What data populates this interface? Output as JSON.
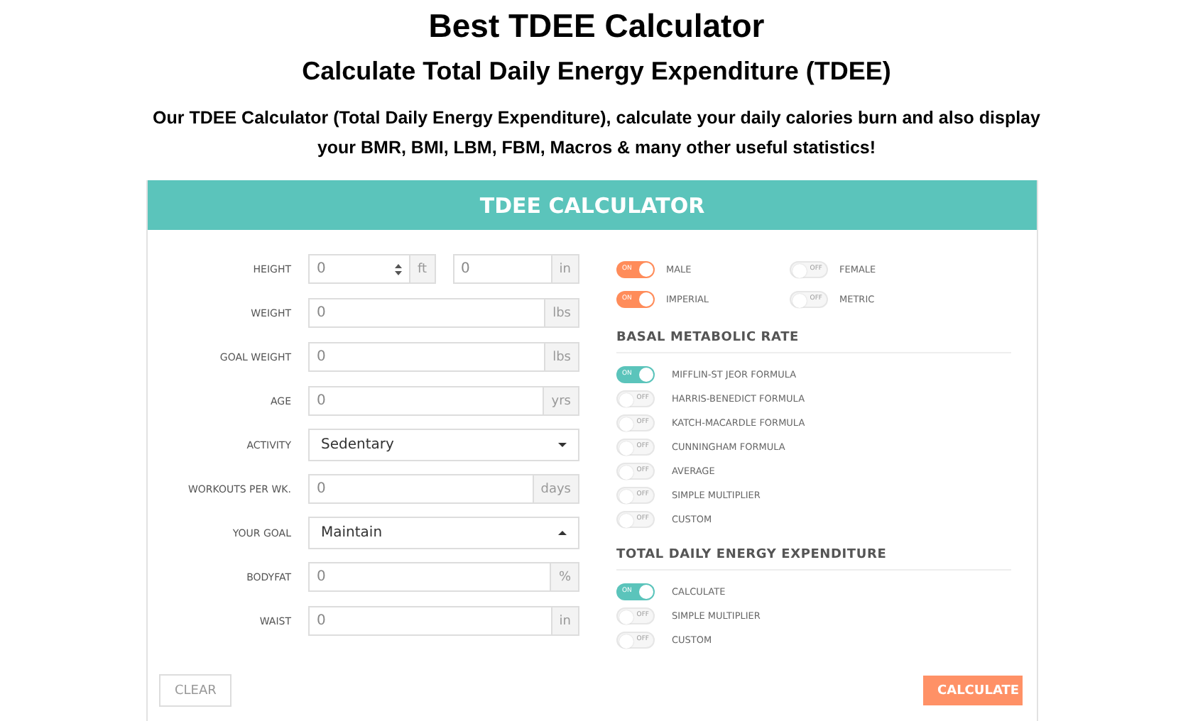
{
  "page": {
    "title": "Best TDEE Calculator",
    "subtitle": "Calculate Total Daily Energy Expenditure (TDEE)",
    "intro": "Our TDEE Calculator (Total Daily Energy Expenditure), calculate your daily calories burn and also display your BMR, BMI, LBM, FBM, Macros & many other useful statistics!"
  },
  "card": {
    "title": "TDEE CALCULATOR",
    "fields": [
      {
        "label": "HEIGHT",
        "kind": "pair",
        "inputs": [
          {
            "placeholder": "0",
            "unit": "ft",
            "spinner": true
          },
          {
            "placeholder": "0",
            "unit": "in",
            "spinner": false
          }
        ]
      },
      {
        "label": "WEIGHT",
        "kind": "number",
        "placeholder": "0",
        "unit": "lbs"
      },
      {
        "label": "GOAL WEIGHT",
        "kind": "number",
        "placeholder": "0",
        "unit": "lbs"
      },
      {
        "label": "AGE",
        "kind": "number",
        "placeholder": "0",
        "unit": "yrs"
      },
      {
        "label": "ACTIVITY",
        "kind": "select",
        "value": "Sedentary",
        "expanded": false
      },
      {
        "label": "WORKOUTS PER WK.",
        "kind": "number",
        "placeholder": "0",
        "unit": "days"
      },
      {
        "label": "YOUR GOAL",
        "kind": "select",
        "value": "Maintain",
        "expanded": true
      },
      {
        "label": "BODYFAT",
        "kind": "number",
        "placeholder": "0",
        "unit": "%"
      },
      {
        "label": "WAIST",
        "kind": "number",
        "placeholder": "0",
        "unit": "in"
      }
    ],
    "options": {
      "color": "#ff8c5a",
      "rows": [
        [
          {
            "label": "MALE",
            "on": true,
            "text": "ON"
          },
          {
            "label": "FEMALE",
            "on": false,
            "text": "OFF"
          }
        ],
        [
          {
            "label": "IMPERIAL",
            "on": true,
            "text": "ON"
          },
          {
            "label": "METRIC",
            "on": false,
            "text": "OFF"
          }
        ]
      ]
    },
    "sections": [
      {
        "title": "BASAL METABOLIC RATE",
        "color": "#5bc4bb",
        "toggles": [
          {
            "label": "MIFFLIN-ST JEOR FORMULA",
            "on": true,
            "text": "ON"
          },
          {
            "label": "HARRIS-BENEDICT FORMULA",
            "on": false,
            "text": "OFF"
          },
          {
            "label": "KATCH-MACARDLE FORMULA",
            "on": false,
            "text": "OFF"
          },
          {
            "label": "CUNNINGHAM FORMULA",
            "on": false,
            "text": "OFF"
          },
          {
            "label": "AVERAGE",
            "on": false,
            "text": "OFF"
          },
          {
            "label": "SIMPLE MULTIPLIER",
            "on": false,
            "text": "OFF"
          },
          {
            "label": "CUSTOM",
            "on": false,
            "text": "OFF"
          }
        ]
      },
      {
        "title": "TOTAL DAILY ENERGY EXPENDITURE",
        "color": "#5bc4bb",
        "toggles": [
          {
            "label": "CALCULATE",
            "on": true,
            "text": "ON"
          },
          {
            "label": "SIMPLE MULTIPLIER",
            "on": false,
            "text": "OFF"
          },
          {
            "label": "CUSTOM",
            "on": false,
            "text": "OFF"
          }
        ]
      }
    ],
    "buttons": {
      "clear": "CLEAR",
      "calculate": "CALCULATE"
    }
  }
}
